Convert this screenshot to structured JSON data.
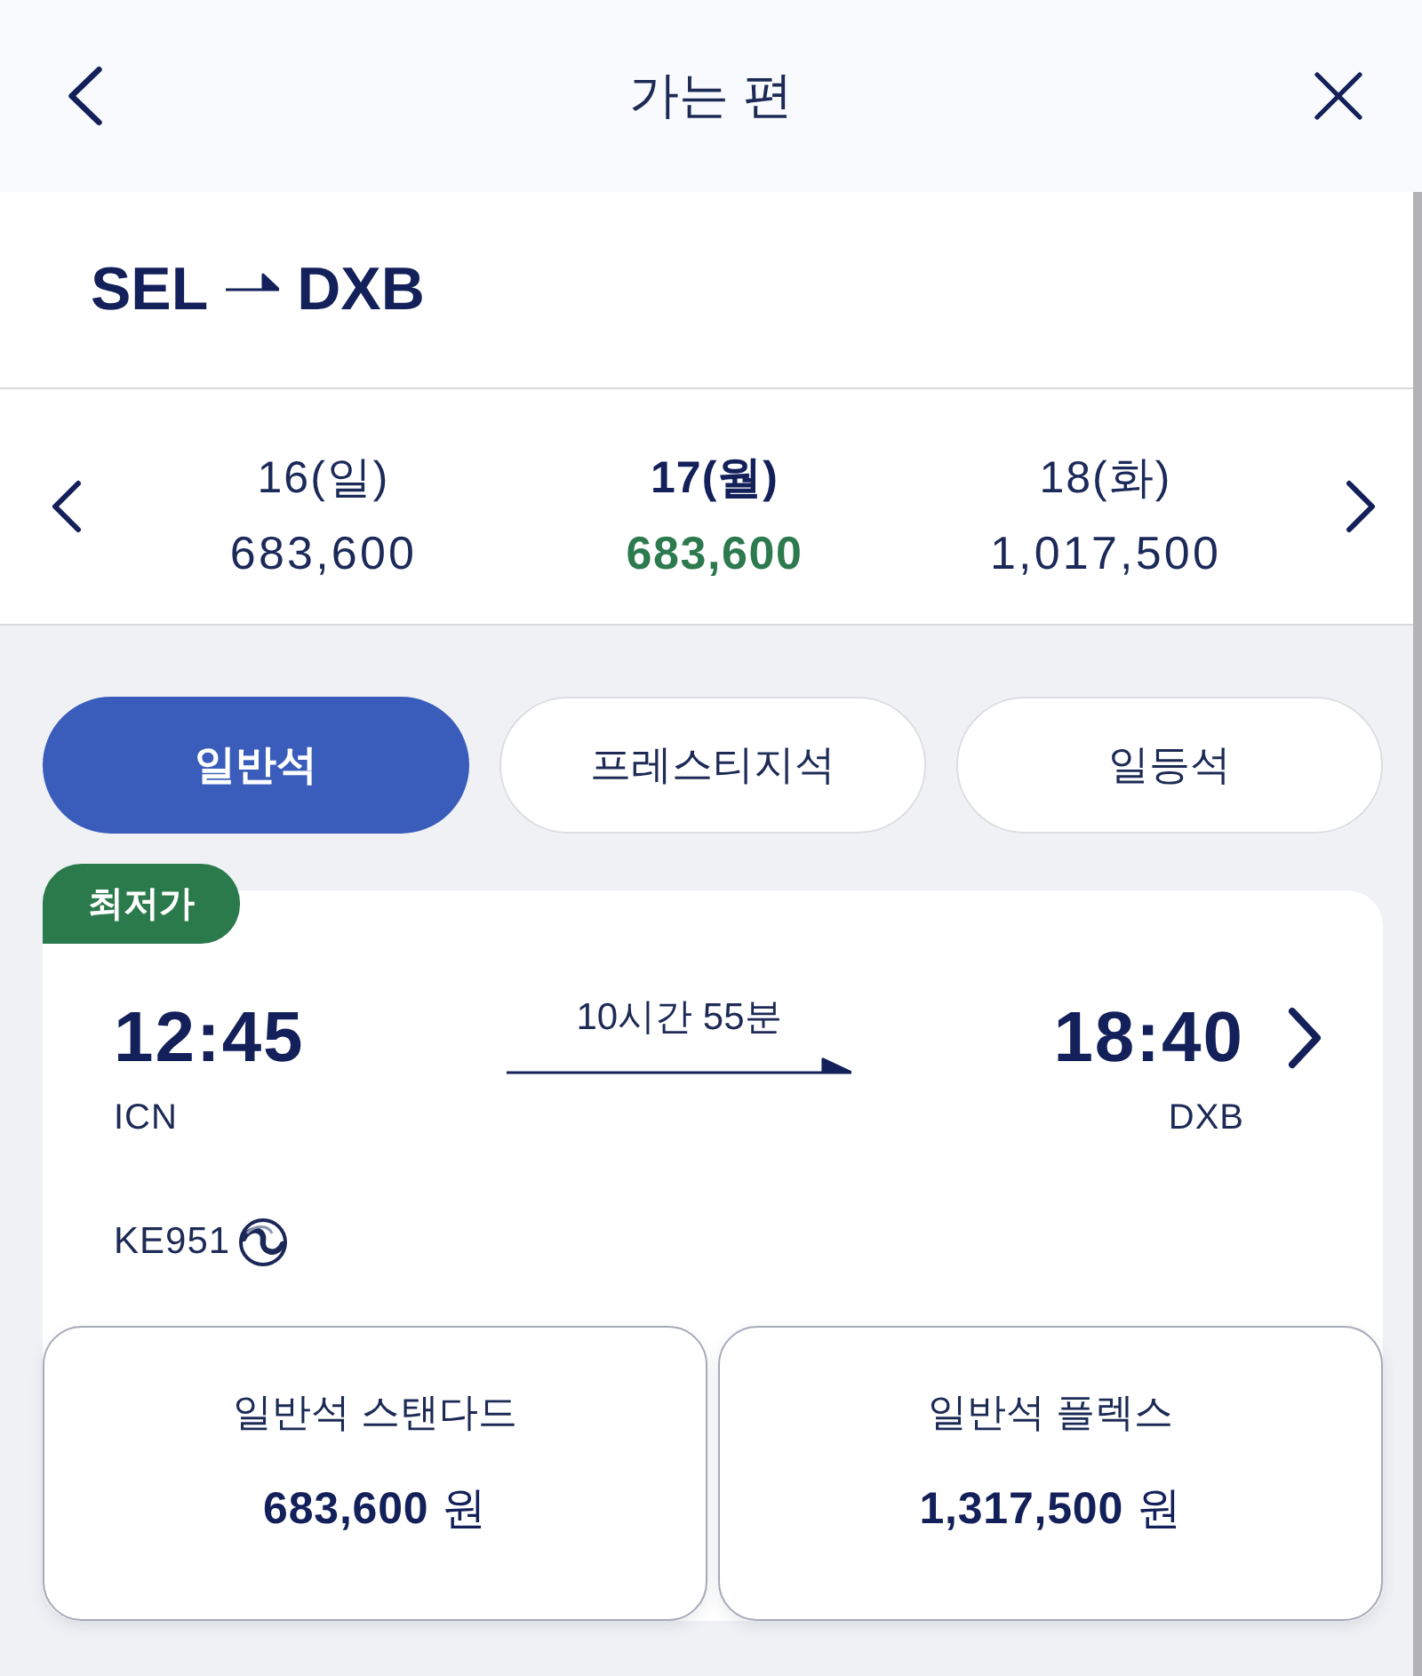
{
  "header": {
    "title": "가는 편"
  },
  "route": {
    "origin": "SEL",
    "destination": "DXB"
  },
  "dates": [
    {
      "day": "16(일)",
      "price": "683,600",
      "selected": false
    },
    {
      "day": "17(월)",
      "price": "683,600",
      "selected": true
    },
    {
      "day": "18(화)",
      "price": "1,017,500",
      "selected": false
    }
  ],
  "cabin_tabs": [
    {
      "label": "일반석",
      "selected": true
    },
    {
      "label": "프레스티지석",
      "selected": false
    },
    {
      "label": "일등석",
      "selected": false
    }
  ],
  "flight": {
    "badge": "최저가",
    "departure_time": "12:45",
    "departure_airport": "ICN",
    "duration": "10시간 55분",
    "arrival_time": "18:40",
    "arrival_airport": "DXB",
    "flight_number": "KE951"
  },
  "fares": [
    {
      "name": "일반석 스탠다드",
      "price": "**683,600** 원"
    },
    {
      "name": "일반석 플렉스",
      "price": "**1,317,500** 원"
    }
  ]
}
